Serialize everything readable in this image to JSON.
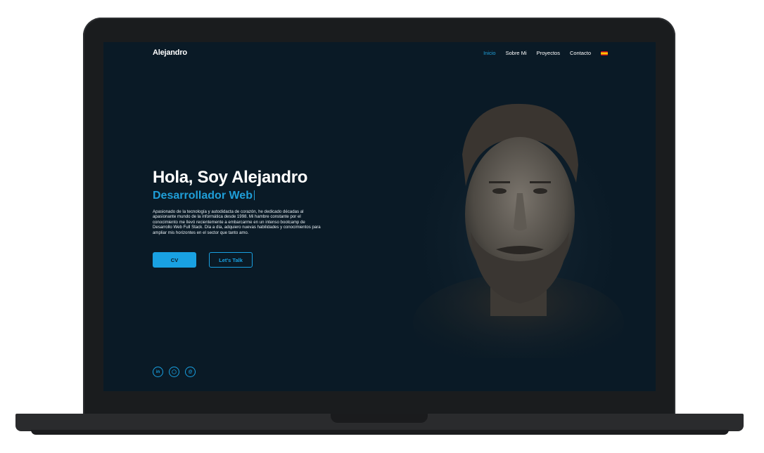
{
  "site": {
    "brand": "Alejandro"
  },
  "nav": {
    "items": [
      {
        "label": "Inicio",
        "active": true
      },
      {
        "label": "Sobre Mi",
        "active": false
      },
      {
        "label": "Proyectos",
        "active": false
      },
      {
        "label": "Contacto",
        "active": false
      }
    ],
    "language_icon": "spain-flag-icon"
  },
  "hero": {
    "title": "Hola, Soy Alejandro",
    "subtitle": "Desarrollador Web",
    "description": "Apasionado de la tecnología y autodidacta de corazón, he dedicado décadas al apasionante mundo de la informática desde 1998. Mi hambre constante por el conocimiento me llevó recientemente a embarcarme en un intenso bootcamp de Desarrollo Web Full Stack. Día a día, adquiero nuevas habilidades y conocimientos para ampliar mis horizontes en el sector que tanto amo.",
    "cv_label": "CV",
    "talk_label": "Let's Talk"
  },
  "socials": [
    {
      "icon": "linkedin-icon",
      "glyph": "in"
    },
    {
      "icon": "github-icon",
      "glyph": "◯"
    },
    {
      "icon": "mail-icon",
      "glyph": "@"
    }
  ],
  "colors": {
    "background": "#0a1a26",
    "accent": "#19a1e2",
    "text": "#ffffff"
  }
}
